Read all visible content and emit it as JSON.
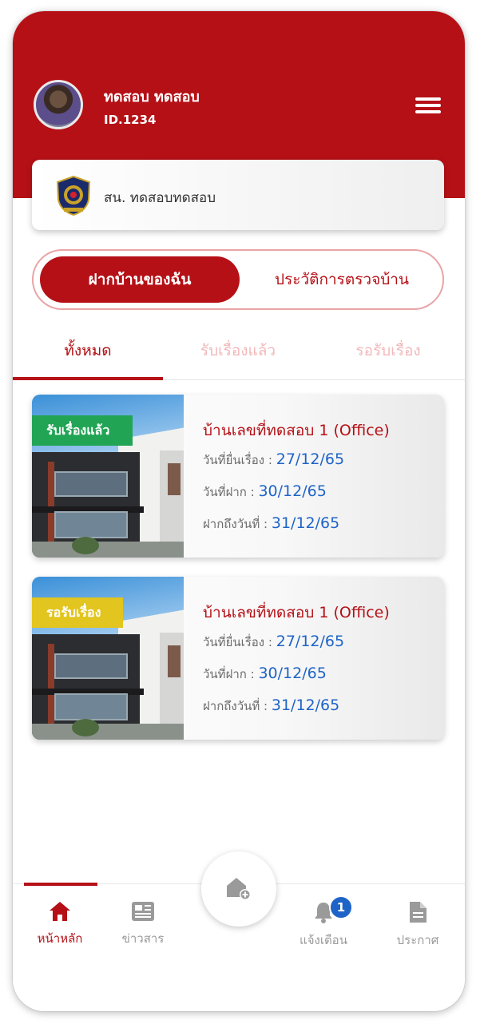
{
  "user": {
    "name": "ทดสอบ ทดสอบ",
    "id": "ID.1234"
  },
  "station": {
    "name": "สน. ทดสอบทดสอบ"
  },
  "segmented": {
    "active": "ฝากบ้านของฉัน",
    "inactive": "ประวัติการตรวจบ้าน"
  },
  "tabs": [
    {
      "label": "ทั้งหมด"
    },
    {
      "label": "รับเรื่องแล้ว"
    },
    {
      "label": "รอรับเรื่อง"
    }
  ],
  "cards": [
    {
      "status": "รับเรื่องแล้ว",
      "status_color": "#22a455",
      "title": "บ้านเลขที่ทดสอบ 1 (Office)",
      "rows": [
        {
          "label": "วันที่ยื่นเรื่อง :",
          "value": "27/12/65"
        },
        {
          "label": "วันที่ฝาก :",
          "value": "30/12/65"
        },
        {
          "label": "ฝากถึงวันที่ :",
          "value": "31/12/65"
        }
      ]
    },
    {
      "status": "รอรับเรื่อง",
      "status_color": "#e2c51e",
      "title": "บ้านเลขที่ทดสอบ 1 (Office)",
      "rows": [
        {
          "label": "วันที่ยื่นเรื่อง :",
          "value": "27/12/65"
        },
        {
          "label": "วันที่ฝาก :",
          "value": "30/12/65"
        },
        {
          "label": "ฝากถึงวันที่ :",
          "value": "31/12/65"
        }
      ]
    }
  ],
  "nav": {
    "home": "หน้าหลัก",
    "news": "ข่าวสาร",
    "notifications": "แจ้งเตือน",
    "notification_count": "1",
    "announcements": "ประกาศ"
  },
  "colors": {
    "primary": "#b51016",
    "accent_blue": "#1e64c8",
    "tab_inactive": "#f2b8ba"
  },
  "icons": {
    "menu": "hamburger-menu-icon",
    "home": "home-icon",
    "news": "newspaper-icon",
    "notifications": "bell-icon",
    "announcements": "document-icon",
    "fab": "house-add-icon"
  }
}
